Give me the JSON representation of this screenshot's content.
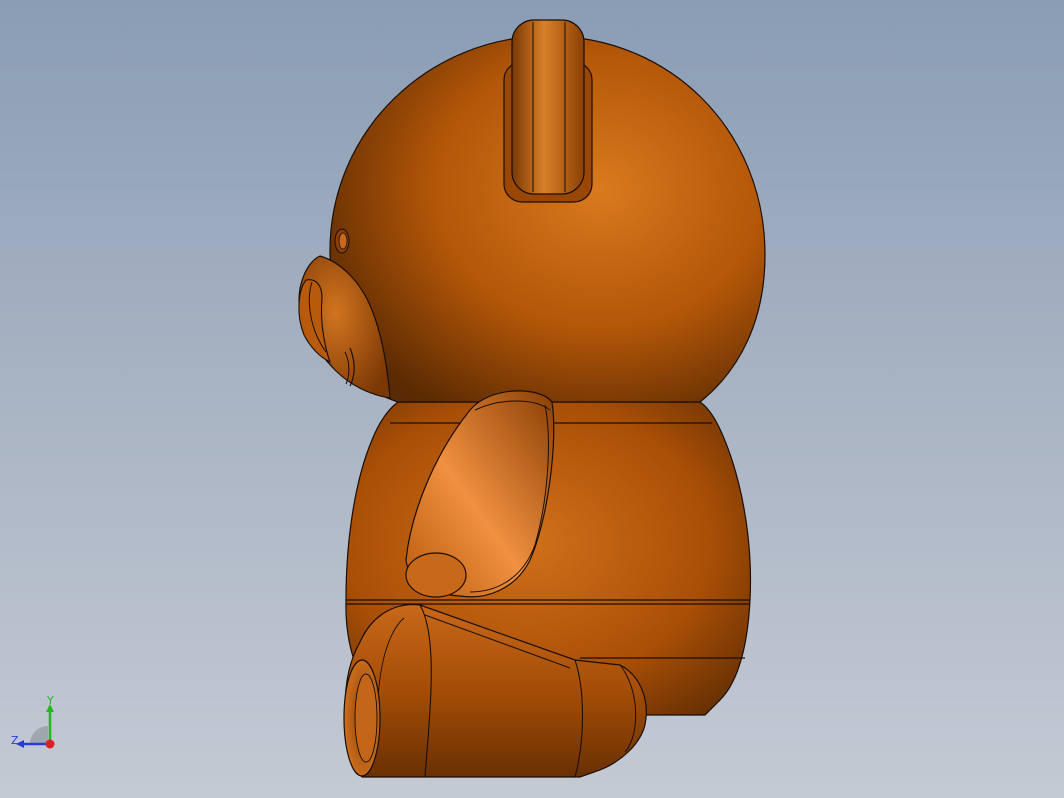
{
  "viewport": {
    "background_top": "#8a9db5",
    "background_bottom": "#c4cad4"
  },
  "model": {
    "subject": "teddy-bear",
    "view": "side",
    "color": "#b85a0c",
    "edge_color": "#1a0e05"
  },
  "triad": {
    "x_label": "",
    "y_label": "Y",
    "z_label": "Z",
    "y_color": "#1fb81f",
    "z_color": "#2a3bd8",
    "x_color": "#e02020"
  }
}
